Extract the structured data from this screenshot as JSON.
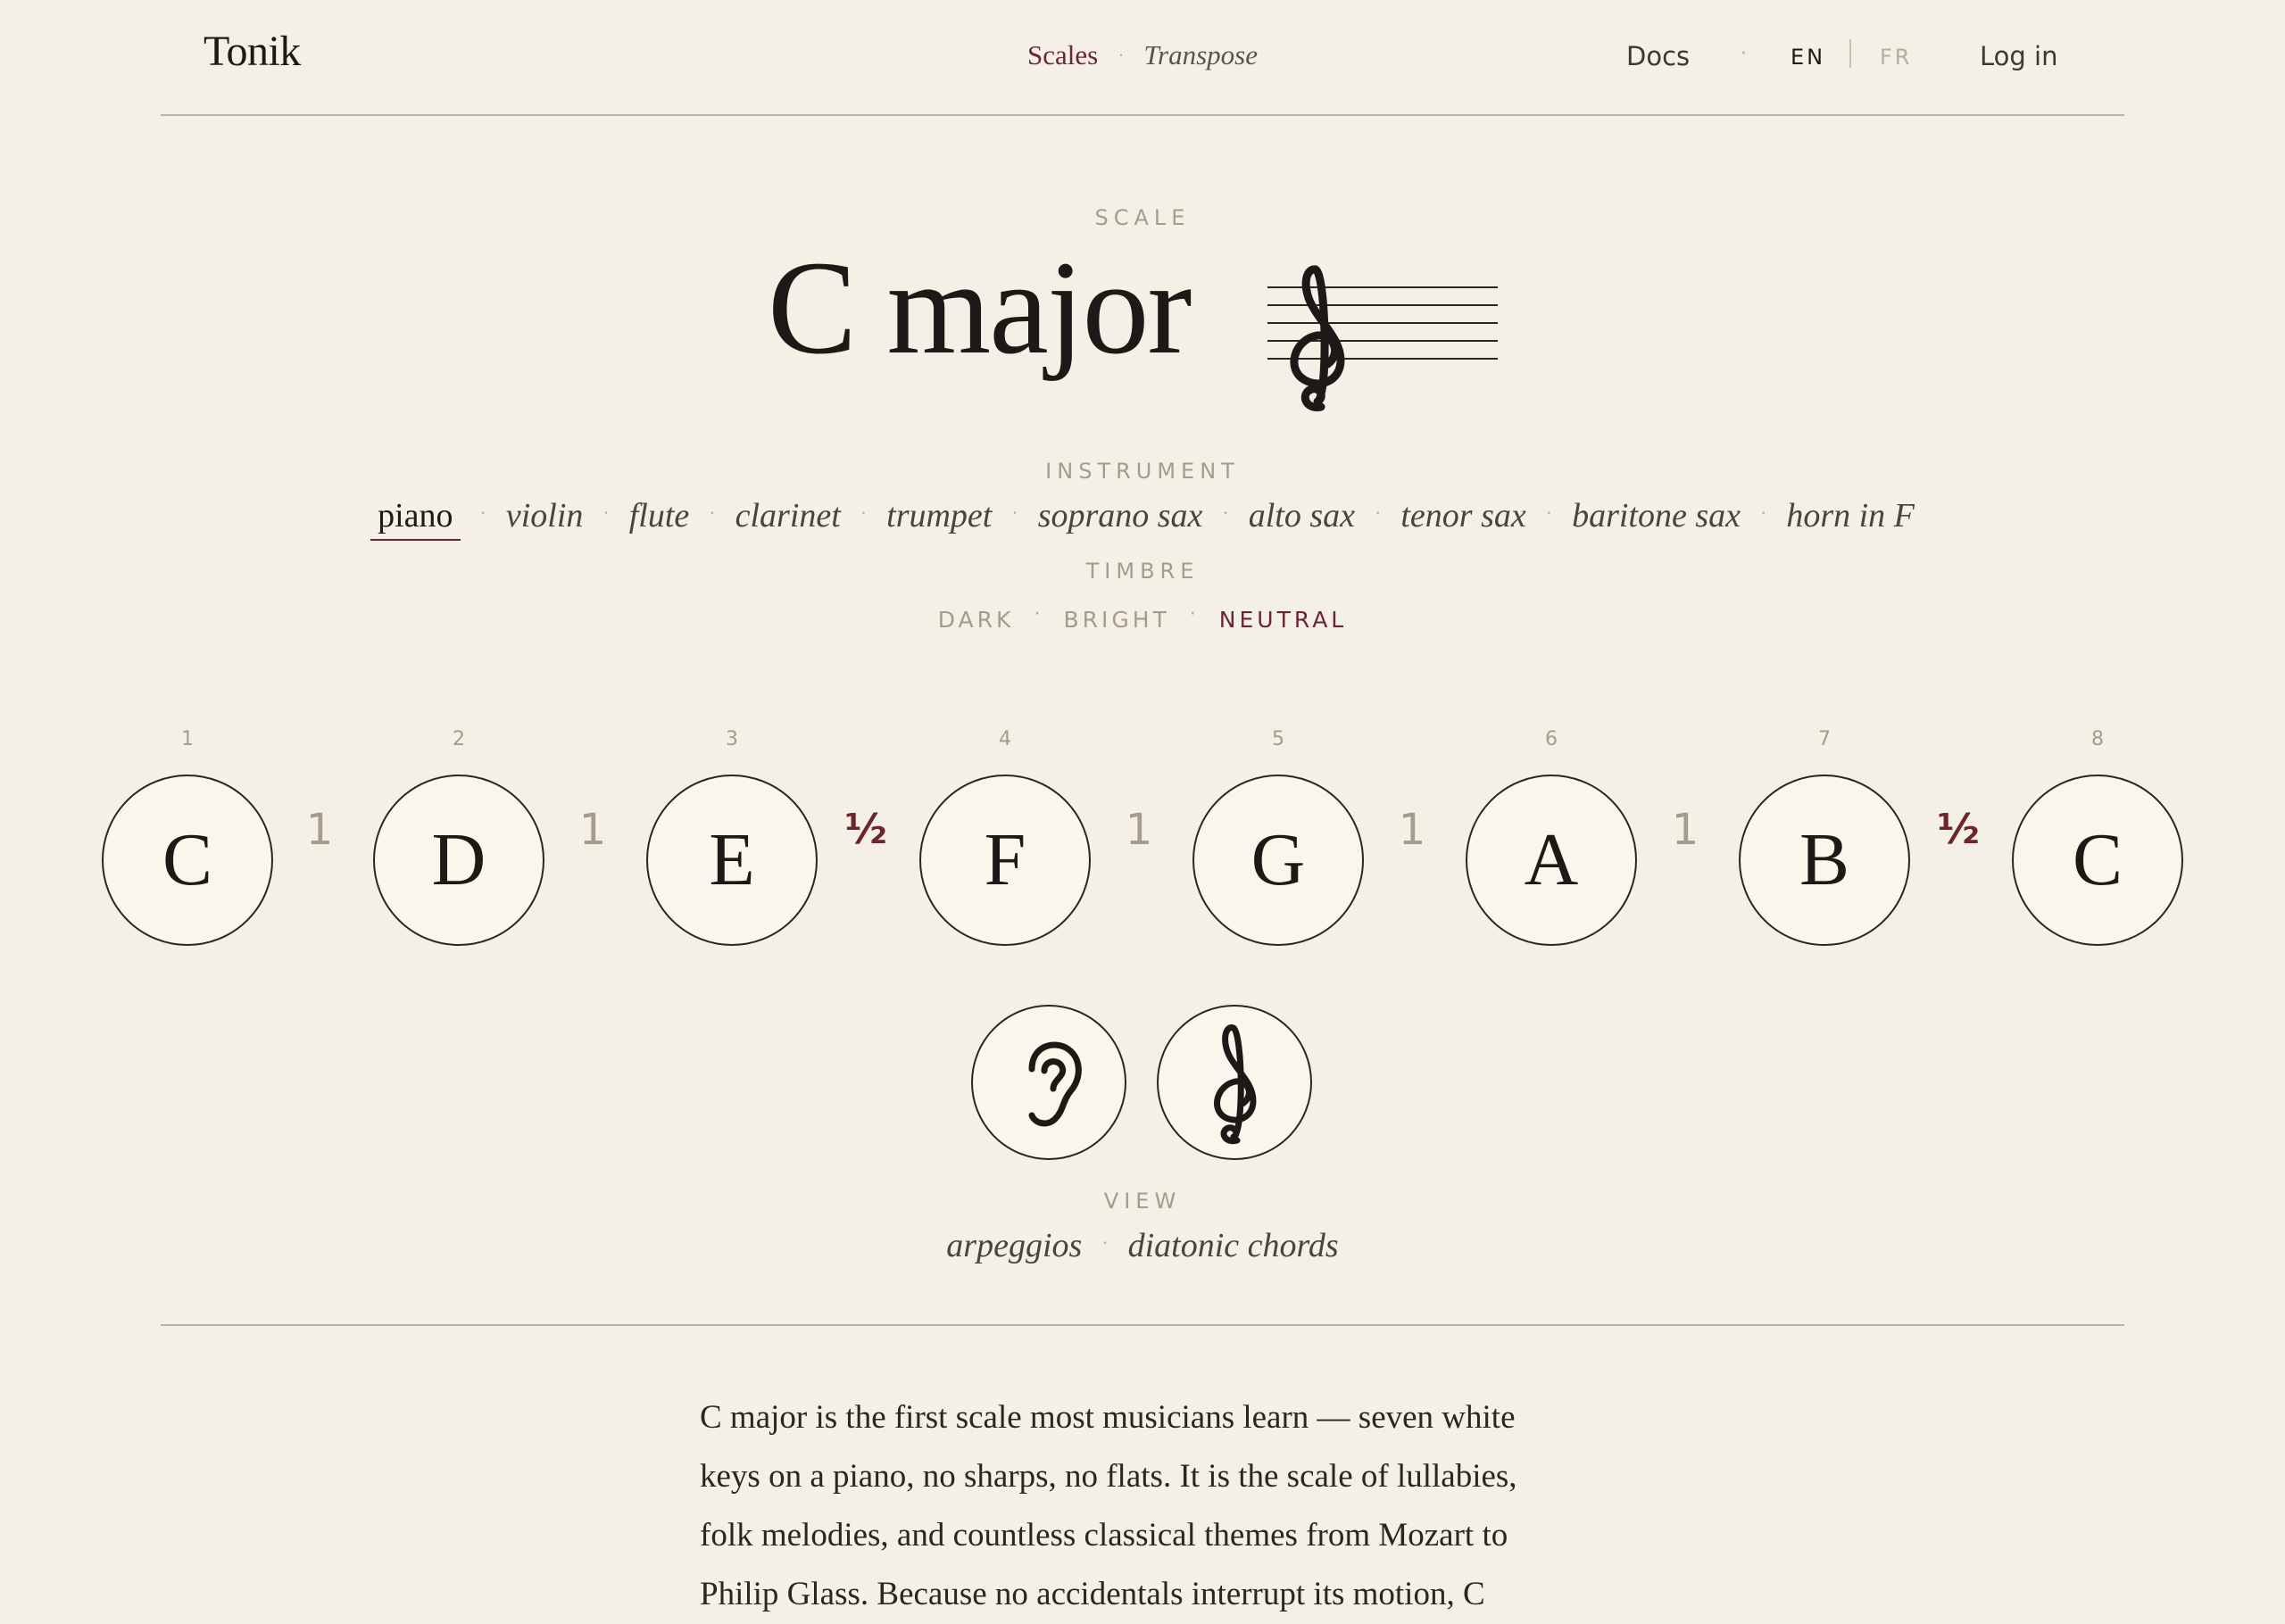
{
  "header": {
    "brand": "Tonik",
    "nav": {
      "scales": "Scales",
      "transpose": "Transpose",
      "sep": "·"
    },
    "docs": "Docs",
    "sep": "·",
    "lang": {
      "en": "EN",
      "fr": "FR"
    },
    "login": "Log in"
  },
  "scale": {
    "eyebrow": "SCALE",
    "title": "C major"
  },
  "instrument": {
    "eyebrow": "INSTRUMENT",
    "items": [
      "piano",
      "violin",
      "flute",
      "clarinet",
      "trumpet",
      "soprano sax",
      "alto sax",
      "tenor sax",
      "baritone sax",
      "horn in F"
    ],
    "selected": "piano"
  },
  "timbre": {
    "eyebrow": "TIMBRE",
    "items": [
      "DARK",
      "BRIGHT",
      "NEUTRAL"
    ],
    "selected": "NEUTRAL"
  },
  "notes": [
    {
      "degree": "1",
      "name": "C"
    },
    {
      "degree": "2",
      "name": "D"
    },
    {
      "degree": "3",
      "name": "E"
    },
    {
      "degree": "4",
      "name": "F"
    },
    {
      "degree": "5",
      "name": "G"
    },
    {
      "degree": "6",
      "name": "A"
    },
    {
      "degree": "7",
      "name": "B"
    },
    {
      "degree": "8",
      "name": "C"
    }
  ],
  "steps": [
    "1",
    "1",
    "½",
    "1",
    "1",
    "1",
    "½"
  ],
  "tools": [
    {
      "icon": "ear-icon"
    },
    {
      "icon": "treble-clef-icon"
    }
  ],
  "view": {
    "eyebrow": "VIEW",
    "items": [
      "arpeggios",
      "diatonic chords"
    ]
  },
  "description": "C major is the first scale most musicians learn — seven white keys on a piano, no sharps, no flats. It is the scale of lullabies, folk melodies, and countless classical themes from Mozart to Philip Glass. Because no accidentals interrupt its motion, C",
  "colors": {
    "background": "#f5f0e6",
    "accent": "#6b2630",
    "muted": "#a49c8f",
    "ink": "#1c1a16"
  }
}
